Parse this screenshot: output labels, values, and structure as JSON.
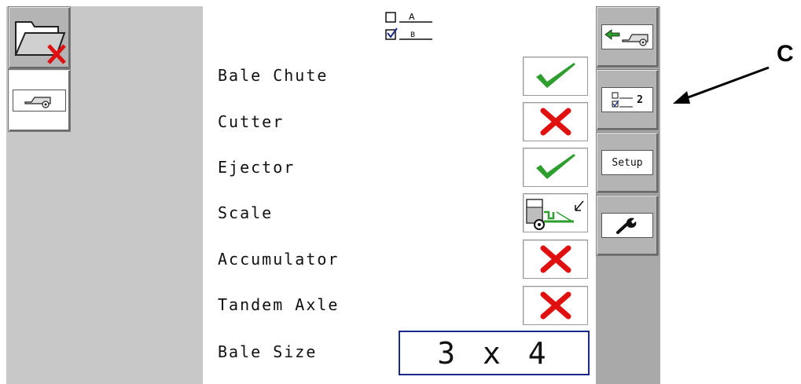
{
  "left_panel": {
    "keys": [
      {
        "name": "folder-cancel",
        "icon": "folder-with-red-x-icon"
      },
      {
        "name": "baler",
        "icon": "baler-icon"
      }
    ]
  },
  "main": {
    "header_icon": "checklist-ab-icon",
    "header_a": "A",
    "header_b": "B",
    "rows": [
      {
        "label": "Bale Chute",
        "status": "enabled",
        "icon": "green-check-icon"
      },
      {
        "label": "Cutter",
        "status": "disabled",
        "icon": "red-x-icon"
      },
      {
        "label": "Ejector",
        "status": "enabled",
        "icon": "green-check-icon"
      },
      {
        "label": "Scale",
        "status": "scale",
        "icon": "baler-scale-icon"
      },
      {
        "label": "Accumulator",
        "status": "disabled",
        "icon": "red-x-icon"
      },
      {
        "label": "Tandem Axle",
        "status": "disabled",
        "icon": "red-x-icon"
      }
    ],
    "bale_size": {
      "label": "Bale Size",
      "value": "3 x 4"
    }
  },
  "right_panel": {
    "keys": [
      {
        "name": "back-to-baler",
        "icon": "back-arrow-baler-icon"
      },
      {
        "name": "config-page",
        "icon": "checklist-ab-icon",
        "label": "2"
      },
      {
        "name": "setup",
        "label": "Setup"
      },
      {
        "name": "tools",
        "icon": "wrench-icon"
      }
    ]
  },
  "callout": {
    "label": "C"
  },
  "colors": {
    "check": "#2e9e2e",
    "cross": "#e01010",
    "outline_blue": "#1a2a8a"
  }
}
